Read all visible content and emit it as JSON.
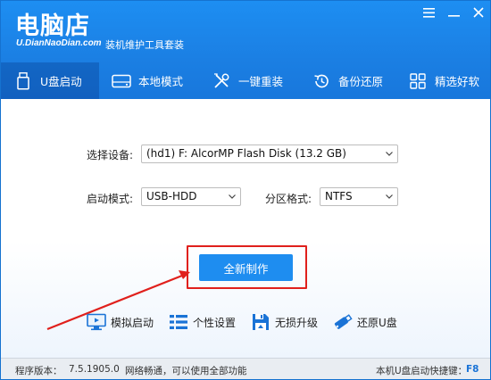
{
  "app": {
    "logo": "电脑店",
    "url": "U.DianNaoDian.com",
    "subtitle": "装机维护工具套装"
  },
  "tabs": [
    {
      "label": "U盘启动",
      "icon": "usb-icon",
      "active": true
    },
    {
      "label": "本地模式",
      "icon": "hard-disk-icon",
      "active": false
    },
    {
      "label": "一键重装",
      "icon": "tools-icon",
      "active": false
    },
    {
      "label": "备份还原",
      "icon": "restore-icon",
      "active": false
    },
    {
      "label": "精选好软",
      "icon": "apps-grid-icon",
      "active": false
    }
  ],
  "form": {
    "device_label": "选择设备:",
    "device_value": "(hd1) F: AlcorMP Flash Disk (13.2 GB)",
    "boot_mode_label": "启动模式:",
    "boot_mode_value": "USB-HDD",
    "partition_label": "分区格式:",
    "partition_value": "NTFS"
  },
  "primary_button": "全新制作",
  "tools": [
    {
      "label": "模拟启动",
      "icon": "monitor-icon"
    },
    {
      "label": "个性设置",
      "icon": "settings-list-icon"
    },
    {
      "label": "无损升级",
      "icon": "floppy-upgrade-icon"
    },
    {
      "label": "还原U盘",
      "icon": "usb-restore-icon"
    }
  ],
  "status": {
    "version_label": "程序版本：",
    "version": "7.5.1905.0",
    "network": "网络畅通，可以使用全部功能",
    "hotkey_label": "本机U盘启动快捷键：",
    "hotkey": "F8"
  },
  "colors": {
    "header_blue": "#1b7fe3",
    "accent": "#1e8df0",
    "annotation_red": "#e0201c"
  }
}
